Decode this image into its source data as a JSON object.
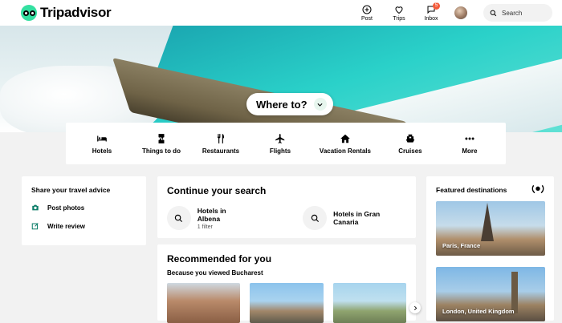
{
  "app": {
    "brand": "Tripadvisor"
  },
  "header": {
    "post_label": "Post",
    "trips_label": "Trips",
    "inbox_label": "Inbox",
    "inbox_badge": "5",
    "search_placeholder": "Search"
  },
  "hero": {
    "where_label": "Where to?"
  },
  "categories": [
    {
      "label": "Hotels",
      "icon": "bed-icon"
    },
    {
      "label": "Things to do",
      "icon": "ticket-icon"
    },
    {
      "label": "Restaurants",
      "icon": "fork-knife-icon"
    },
    {
      "label": "Flights",
      "icon": "airplane-icon"
    },
    {
      "label": "Vacation Rentals",
      "icon": "house-icon"
    },
    {
      "label": "Cruises",
      "icon": "ship-icon"
    },
    {
      "label": "More",
      "icon": "more-dots-icon"
    }
  ],
  "share": {
    "title": "Share your travel advice",
    "post_photos": "Post photos",
    "write_review": "Write review"
  },
  "continue": {
    "title": "Continue your search",
    "items": [
      {
        "title": "Hotels in Albena",
        "subtitle": "1 filter"
      },
      {
        "title": "Hotels in Gran Canaria",
        "subtitle": ""
      }
    ]
  },
  "recommended": {
    "title": "Recommended for you",
    "subtitle": "Because you viewed Bucharest"
  },
  "featured": {
    "title": "Featured destinations",
    "destinations": [
      {
        "label": "Paris, France"
      },
      {
        "label": "London, United Kingdom"
      }
    ]
  },
  "colors": {
    "brand": "#34e0a1",
    "badge": "#f35b3b"
  }
}
